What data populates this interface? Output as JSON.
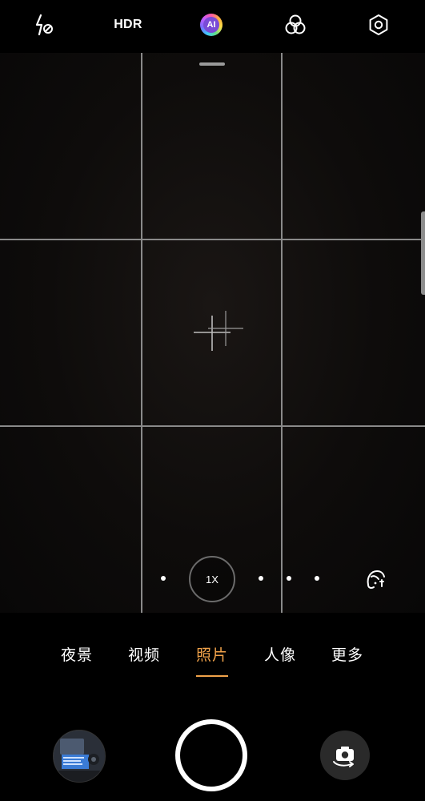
{
  "topbar": {
    "flash_icon": "flash-off-icon",
    "hdr_label": "HDR",
    "ai_label": "AI",
    "filters_icon": "filters-icon",
    "settings_icon": "settings-icon"
  },
  "viewfinder": {
    "grid": "3x3",
    "zoom_label": "1X",
    "zoom_dots": 4,
    "beauty_icon": "beauty-face-icon"
  },
  "modes": {
    "items": [
      {
        "label": "夜景",
        "active": false
      },
      {
        "label": "视频",
        "active": false
      },
      {
        "label": "照片",
        "active": true
      },
      {
        "label": "人像",
        "active": false
      },
      {
        "label": "更多",
        "active": false
      }
    ]
  },
  "bottom": {
    "gallery_icon": "gallery-thumbnail",
    "shutter_icon": "shutter-button",
    "switch_icon": "switch-camera-icon"
  },
  "colors": {
    "accent": "#f0a24a",
    "background": "#000000",
    "grid_line": "#8a8a8a"
  }
}
